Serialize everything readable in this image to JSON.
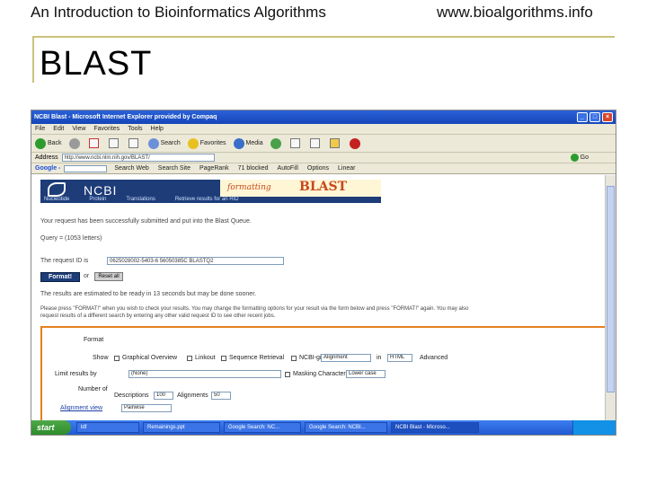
{
  "slide": {
    "header_left": "An Introduction to Bioinformatics Algorithms",
    "header_right": "www.bioalgorithms.info",
    "title": "BLAST"
  },
  "browser": {
    "window_title": "NCBI Blast - Microsoft Internet Explorer provided by Compaq",
    "menu": [
      "File",
      "Edit",
      "View",
      "Favorites",
      "Tools",
      "Help"
    ],
    "toolbar": {
      "back": "Back",
      "search": "Search",
      "favorites": "Favorites",
      "media": "Media"
    },
    "address_label": "Address",
    "address_value": "http://www.ncbi.nlm.nih.gov/BLAST/",
    "go_label": "Go",
    "google": {
      "label": "Google -",
      "search_web": "Search Web",
      "search_site": "Search Site",
      "pagerank": "PageRank",
      "blocked": "71 blocked",
      "autofill": "AutoFill",
      "options": "Options",
      "linear": "Linear"
    }
  },
  "page": {
    "banner_ncbi": "NCBI",
    "banner_formatting": "formatting",
    "banner_blast": "BLAST",
    "banner_links": [
      "Nucleotide",
      "Protein",
      "Translations",
      "Retrieve results for an RID"
    ],
    "submitted_text": "Your request has been successfully submitted and put into the Blast Queue.",
    "query_text": "Query = (1053 letters)",
    "rid_label": "The request ID is",
    "rid_value": "0625028002-5403-6 56050385C BLASTQ2",
    "format_button": "Format!",
    "or_text": "or",
    "reset_button": "Reset all",
    "estimate_text": "The results are estimated to be ready in 13 seconds but may be done sooner.",
    "instructions_1": "Please press \"FORMAT!\" when you wish to check your results. You may change the formatting options for your result via the form below and press \"FORMAT!\" again. You may also",
    "instructions_2": "request results of a different search by entering any other valid request ID to see other recent jobs.",
    "options": {
      "format_label": "Format",
      "show_label": "Show",
      "show_checks": [
        "Graphical Overview",
        "Linkout",
        "Sequence Retrieval",
        "NCBI-gi"
      ],
      "alignment_value": "Alignment",
      "in_text": "in",
      "html_value": "HTML",
      "advanced_label": "Advanced",
      "limit_label": "Limit results by",
      "limit_value": "(None)",
      "masking_label": "Masking Character",
      "masking_value": "Lower case",
      "number_label": "Number of",
      "descriptions_label": "Descriptions",
      "descriptions_value": "100",
      "alignments_label": "Alignments",
      "alignments_value": "50",
      "alignment_view_label": "Alignment view",
      "alignment_view_value": "Pairwise"
    }
  },
  "taskbar": {
    "start": "start",
    "items": [
      "ldf",
      "Remainings.ppt",
      "Google Search: NC...",
      "Google Search: NCBI...",
      "NCBI Blast - Microso..."
    ]
  }
}
